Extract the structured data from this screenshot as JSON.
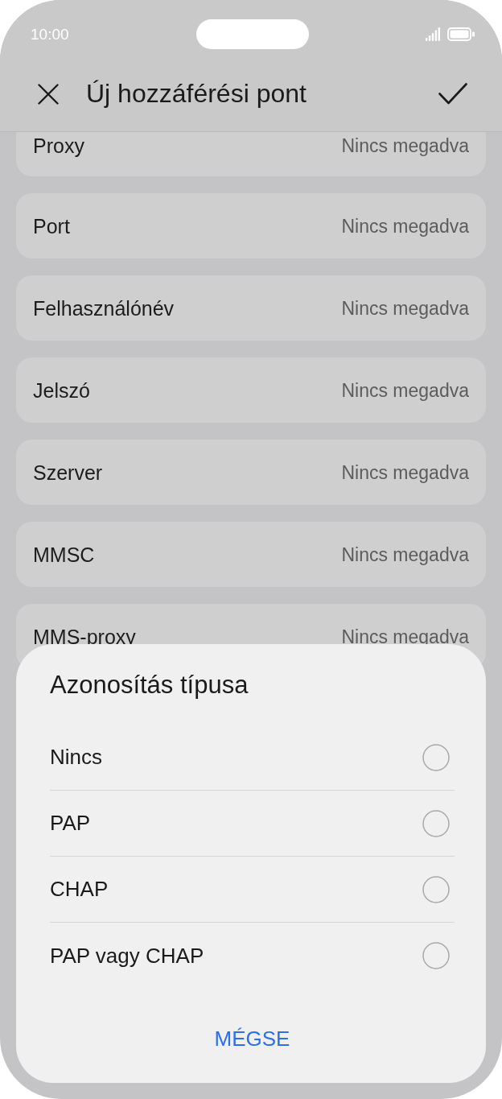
{
  "status_bar": {
    "time": "10:00"
  },
  "header": {
    "title": "Új hozzáférési pont"
  },
  "fields": [
    {
      "label": "Proxy",
      "value": "Nincs megadva"
    },
    {
      "label": "Port",
      "value": "Nincs megadva"
    },
    {
      "label": "Felhasználónév",
      "value": "Nincs megadva"
    },
    {
      "label": "Jelszó",
      "value": "Nincs megadva"
    },
    {
      "label": "Szerver",
      "value": "Nincs megadva"
    },
    {
      "label": "MMSC",
      "value": "Nincs megadva"
    },
    {
      "label": "MMS-proxy",
      "value": "Nincs megadva"
    }
  ],
  "dialog": {
    "title": "Azonosítás típusa",
    "options": [
      {
        "label": "Nincs",
        "selected": false
      },
      {
        "label": "PAP",
        "selected": false
      },
      {
        "label": "CHAP",
        "selected": false
      },
      {
        "label": "PAP vagy CHAP",
        "selected": false
      }
    ],
    "cancel": "MÉGSE"
  }
}
